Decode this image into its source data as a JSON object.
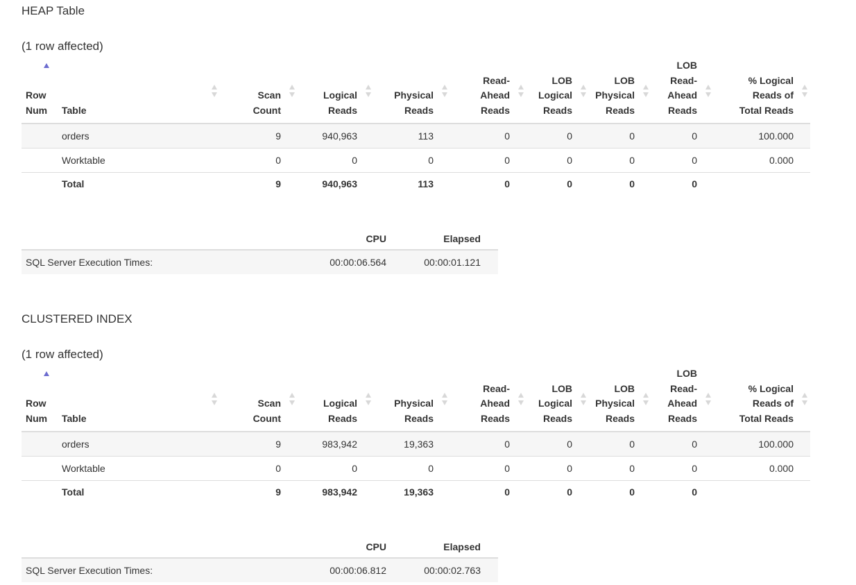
{
  "columns": [
    {
      "label": "Row Num",
      "lines": [
        "Row",
        "Num"
      ]
    },
    {
      "label": "Table",
      "lines": [
        "Table"
      ]
    },
    {
      "label": "Scan Count",
      "lines": [
        "Scan",
        "Count"
      ]
    },
    {
      "label": "Logical Reads",
      "lines": [
        "Logical",
        "Reads"
      ]
    },
    {
      "label": "Physical Reads",
      "lines": [
        "Physical",
        "Reads"
      ]
    },
    {
      "label": "Read-Ahead Reads",
      "lines": [
        "Read-",
        "Ahead",
        "Reads"
      ]
    },
    {
      "label": "LOB Logical Reads",
      "lines": [
        "LOB",
        "Logical",
        "Reads"
      ]
    },
    {
      "label": "LOB Physical Reads",
      "lines": [
        "LOB",
        "Physical",
        "Reads"
      ]
    },
    {
      "label": "LOB Read-Ahead Reads",
      "lines": [
        "LOB",
        "Read-",
        "Ahead",
        "Reads"
      ]
    },
    {
      "label": "% Logical Reads of Total Reads",
      "lines": [
        "% Logical",
        "Reads of",
        "Total Reads"
      ]
    }
  ],
  "time_columns": [
    "",
    "CPU",
    "Elapsed"
  ],
  "sections": [
    {
      "title": "HEAP Table",
      "affected": "(1 row affected)",
      "rows": [
        [
          "",
          "orders",
          "9",
          "940,963",
          "113",
          "0",
          "0",
          "0",
          "0",
          "100.000"
        ],
        [
          "",
          "Worktable",
          "0",
          "0",
          "0",
          "0",
          "0",
          "0",
          "0",
          "0.000"
        ]
      ],
      "total": [
        "",
        "Total",
        "9",
        "940,963",
        "113",
        "0",
        "0",
        "0",
        "0",
        ""
      ],
      "times": {
        "label": "SQL Server Execution Times:",
        "cpu": "00:00:06.564",
        "elapsed": "00:00:01.121"
      }
    },
    {
      "title": "CLUSTERED INDEX",
      "affected": "(1 row affected)",
      "rows": [
        [
          "",
          "orders",
          "9",
          "983,942",
          "19,363",
          "0",
          "0",
          "0",
          "0",
          "100.000"
        ],
        [
          "",
          "Worktable",
          "0",
          "0",
          "0",
          "0",
          "0",
          "0",
          "0",
          "0.000"
        ]
      ],
      "total": [
        "",
        "Total",
        "9",
        "983,942",
        "19,363",
        "0",
        "0",
        "0",
        "0",
        ""
      ],
      "times": {
        "label": "SQL Server Execution Times:",
        "cpu": "00:00:06.812",
        "elapsed": "00:00:02.763"
      }
    }
  ]
}
